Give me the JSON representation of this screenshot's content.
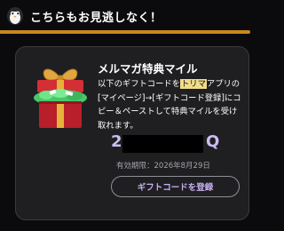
{
  "header": {
    "title": "こちらもお見逃しなく！",
    "mascot_icon": "penguin-icon",
    "accent_color": "#c8891b"
  },
  "card": {
    "title": "メルマガ特典マイル",
    "desc": {
      "part1": "以下のギフトコードを",
      "highlight": "トリマ",
      "part2": "アプリの[マイページ]→[ギフトコード登録]にコピー＆ペーストして特典マイルを受け取れます。"
    },
    "gift_icon": "gift-box-icon",
    "code": {
      "visible_start": "2",
      "visible_end": "Q",
      "masked": true
    },
    "expiry": "有効期限：2026年8月29日",
    "register_button": "ギフトコードを登録"
  }
}
